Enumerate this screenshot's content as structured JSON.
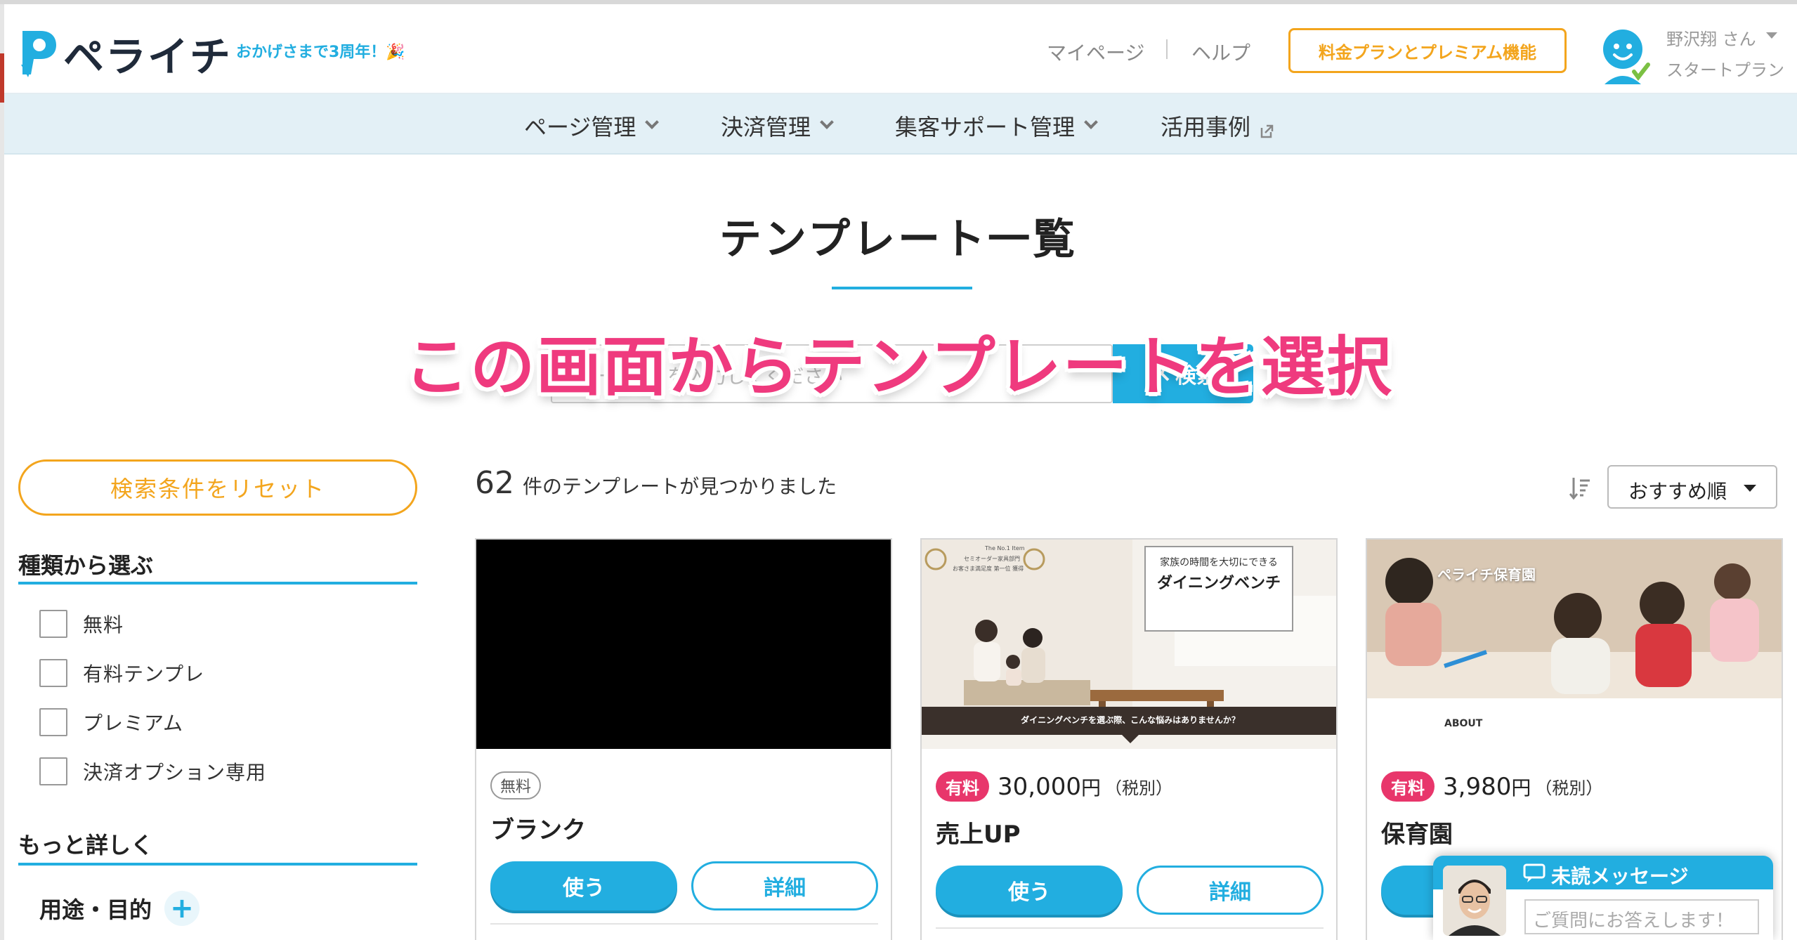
{
  "brand": {
    "logo_text": "ペライチ",
    "anniversary": "おかげさまで3周年！🎉"
  },
  "header": {
    "mypage": "マイページ",
    "help": "ヘルプ",
    "premium_button": "料金プランとプレミアム機能",
    "user_name": "野沢翔 さん",
    "user_plan": "スタートプラン"
  },
  "nav": {
    "items": [
      "ページ管理",
      "決済管理",
      "集客サポート管理",
      "活用事例"
    ]
  },
  "page": {
    "title": "テンプレート一覧",
    "overlay_caption": "この画面からテンプレートを選択",
    "search_placeholder": "キーワードを入力してください",
    "search_button": "検索"
  },
  "sidebar": {
    "reset_button": "検索条件をリセット",
    "type_heading": "種類から選ぶ",
    "type_options": [
      "無料",
      "有料テンプレ",
      "プレミアム",
      "決済オプション専用"
    ],
    "more_heading": "もっと詳しく",
    "purpose_label": "用途・目的",
    "purpose_plus": "+"
  },
  "results": {
    "count": "62",
    "count_text": "件のテンプレートが見つかりました",
    "sort_selected": "おすすめ順"
  },
  "cards": [
    {
      "badge": "無料",
      "price": "",
      "unit": "",
      "tax": "",
      "name": "ブランク",
      "use": "使う",
      "detail": "詳細"
    },
    {
      "badge": "有料",
      "price": "30,000",
      "unit": "円",
      "tax": "（税別）",
      "name": "売上UP",
      "use": "使う",
      "detail": "詳細",
      "thumb": {
        "heading_small": "家族の時間を大切にできる",
        "heading_big": "ダイニングベンチ",
        "banner": "ダイニングベンチを選ぶ際、こんな悩みはありませんか？",
        "award_top": "The No.1 Item",
        "award_line1": "セミオーダー家具部門",
        "award_line2": "お客さま満足度 第一位 獲得"
      }
    },
    {
      "badge": "有料",
      "price": "3,980",
      "unit": "円",
      "tax": "（税別）",
      "name": "保育園",
      "use": "使う",
      "detail": "詳細",
      "thumb": {
        "overlay_title": "ペライチ保育園",
        "about": "ABOUT"
      }
    }
  ],
  "chat": {
    "title": "未読メッセージ",
    "placeholder": "ご質問にお答えします！"
  },
  "colors": {
    "accent": "#22aee0",
    "orange": "#f3a51d",
    "pink": "#e8366b",
    "caption_pink": "#ef3a7e",
    "nav_bg": "#e3f0f6"
  }
}
